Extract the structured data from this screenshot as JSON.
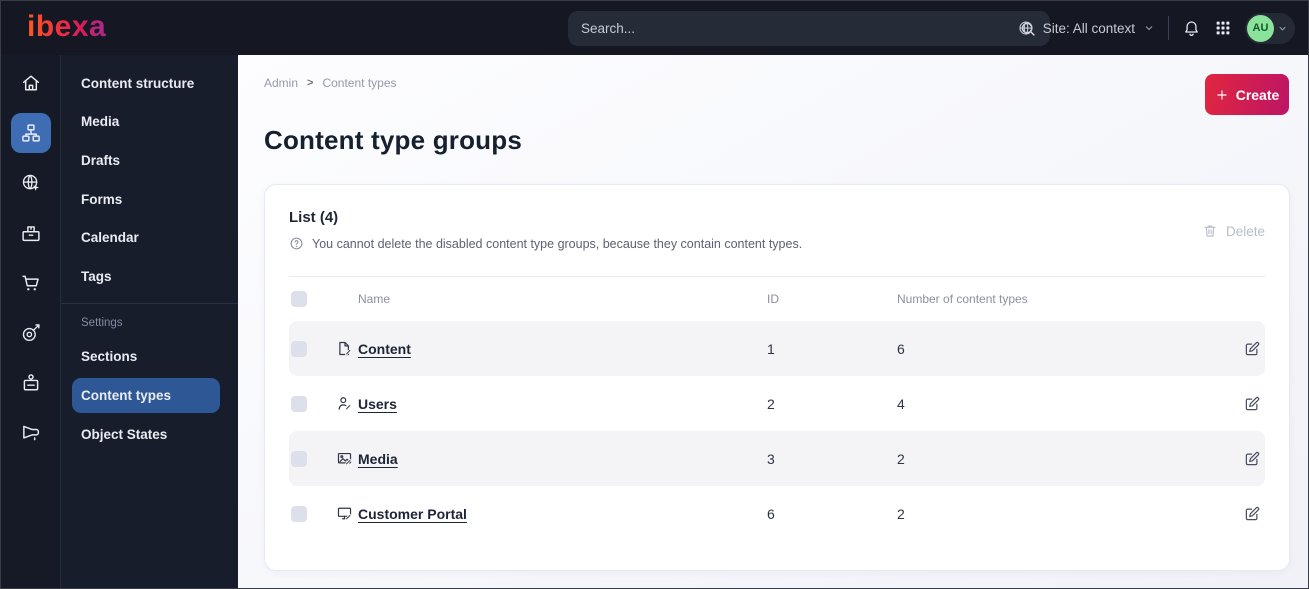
{
  "topbar": {
    "logo": "ibexa",
    "search_placeholder": "Search...",
    "site_label": "Site: All context",
    "avatar": "AU"
  },
  "sidebar": {
    "menu_items": [
      "Content structure",
      "Media",
      "Drafts",
      "Forms",
      "Calendar",
      "Tags"
    ],
    "settings_label": "Settings",
    "settings_items": [
      "Sections",
      "Content types",
      "Object States"
    ],
    "active_item": "Content types",
    "rail_icons": [
      "home",
      "content-tree",
      "site",
      "products",
      "commerce",
      "audience",
      "customer-portal",
      "campaigns"
    ]
  },
  "breadcrumb": {
    "items": [
      "Admin",
      "Content types"
    ],
    "separator": ">"
  },
  "page": {
    "title": "Content type groups",
    "create_label": "Create"
  },
  "panel": {
    "list_title": "List (4)",
    "help_text": "You cannot delete the disabled content type groups, because they contain content types.",
    "delete_label": "Delete",
    "table": {
      "columns": [
        "Name",
        "ID",
        "Number of content types"
      ],
      "rows": [
        {
          "icon": "file",
          "name": "Content",
          "id": "1",
          "count": "6"
        },
        {
          "icon": "user",
          "name": "Users",
          "id": "2",
          "count": "4"
        },
        {
          "icon": "image",
          "name": "Media",
          "id": "3",
          "count": "2"
        },
        {
          "icon": "monitor",
          "name": "Customer Portal",
          "id": "6",
          "count": "2"
        }
      ]
    }
  },
  "colors": {
    "accent_start": "#e0263f",
    "accent_end": "#bd1566",
    "selected_blue": "#2d5795",
    "rail_blue": "#3f6db3",
    "avatar_green": "#8be39b",
    "topbar_bg": "#151823"
  }
}
